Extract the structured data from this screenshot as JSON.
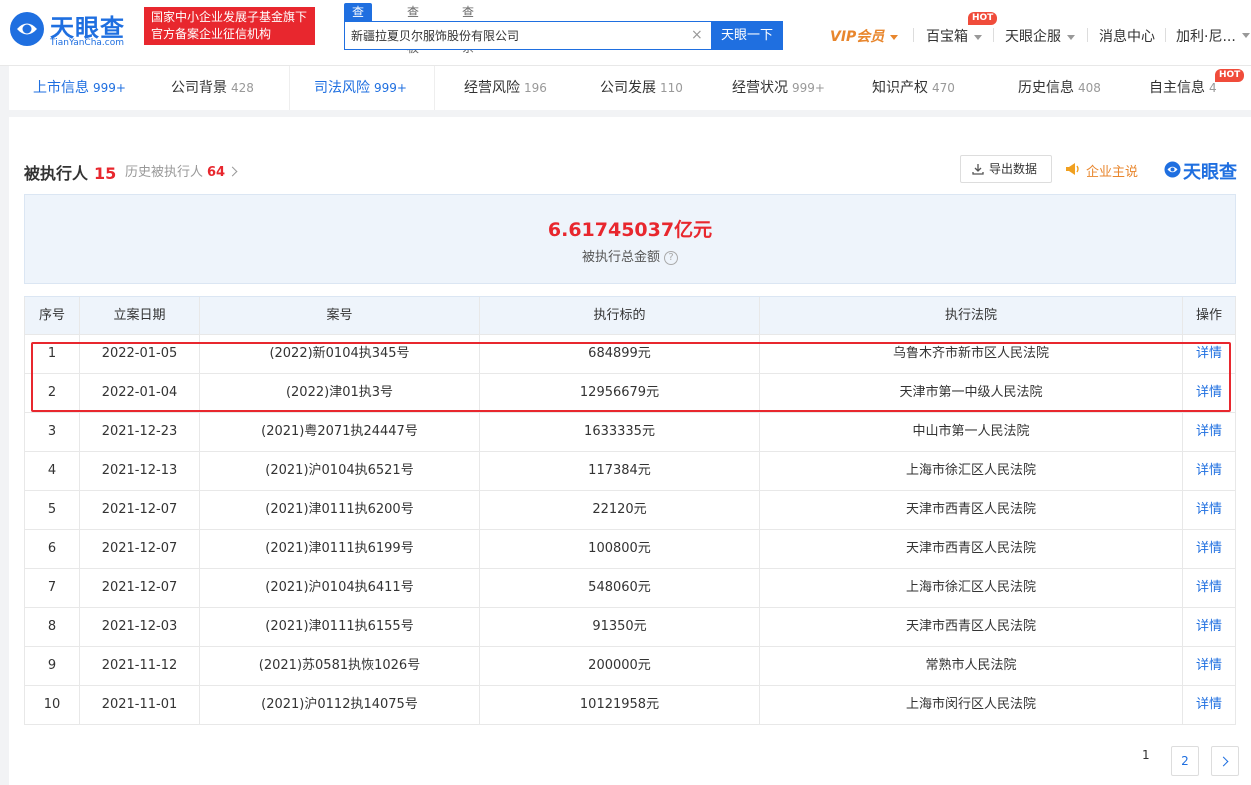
{
  "header": {
    "logo_text": "天眼查",
    "logo_sub": "TianYanCha.com",
    "badge_line1": "国家中小企业发展子基金旗下",
    "badge_line2": "官方备案企业征信机构",
    "search_tabs": [
      "查公司",
      "查老板",
      "查关系"
    ],
    "search_value": "新疆拉夏贝尔服饰股份有限公司",
    "search_button": "天眼一下",
    "nav": {
      "vip": "VIP会员",
      "baobao": "百宝箱",
      "qifu": "天眼企服",
      "messages": "消息中心",
      "user": "加利·尼..."
    },
    "hot_label": "HOT"
  },
  "tabs": [
    {
      "label": "上市信息",
      "count": "999+"
    },
    {
      "label": "公司背景",
      "count": "428"
    },
    {
      "label": "司法风险",
      "count": "999+"
    },
    {
      "label": "经营风险",
      "count": "196"
    },
    {
      "label": "公司发展",
      "count": "110"
    },
    {
      "label": "经营状况",
      "count": "999+"
    },
    {
      "label": "知识产权",
      "count": "470"
    },
    {
      "label": "历史信息",
      "count": "408"
    },
    {
      "label": "自主信息",
      "count": "4"
    }
  ],
  "section": {
    "title": "被执行人",
    "count": "15",
    "history_label": "历史被执行人",
    "history_count": "64",
    "export_label": "导出数据",
    "claim_label": "企业主说",
    "brand_label": "天眼查"
  },
  "summary": {
    "amount": "6.61745037亿元",
    "label": "被执行总金额",
    "help": "?"
  },
  "table": {
    "headers": [
      "序号",
      "立案日期",
      "案号",
      "执行标的",
      "执行法院",
      "操作"
    ],
    "rows": [
      [
        "1",
        "2022-01-05",
        "(2022)新0104执345号",
        "684899元",
        "乌鲁木齐市新市区人民法院",
        "详情"
      ],
      [
        "2",
        "2022-01-04",
        "(2022)津01执3号",
        "12956679元",
        "天津市第一中级人民法院",
        "详情"
      ],
      [
        "3",
        "2021-12-23",
        "(2021)粤2071执24447号",
        "1633335元",
        "中山市第一人民法院",
        "详情"
      ],
      [
        "4",
        "2021-12-13",
        "(2021)沪0104执6521号",
        "117384元",
        "上海市徐汇区人民法院",
        "详情"
      ],
      [
        "5",
        "2021-12-07",
        "(2021)津0111执6200号",
        "22120元",
        "天津市西青区人民法院",
        "详情"
      ],
      [
        "6",
        "2021-12-07",
        "(2021)津0111执6199号",
        "100800元",
        "天津市西青区人民法院",
        "详情"
      ],
      [
        "7",
        "2021-12-07",
        "(2021)沪0104执6411号",
        "548060元",
        "上海市徐汇区人民法院",
        "详情"
      ],
      [
        "8",
        "2021-12-03",
        "(2021)津0111执6155号",
        "91350元",
        "天津市西青区人民法院",
        "详情"
      ],
      [
        "9",
        "2021-11-12",
        "(2021)苏0581执恢1026号",
        "200000元",
        "常熟市人民法院",
        "详情"
      ],
      [
        "10",
        "2021-11-01",
        "(2021)沪0112执14075号",
        "10121958元",
        "上海市闵行区人民法院",
        "详情"
      ]
    ]
  },
  "pagination": {
    "current": "1",
    "next_page": "2"
  },
  "colors": {
    "brand_blue": "#1f6fe0",
    "alert_red": "#e8272e",
    "vip_orange": "#e8862d"
  }
}
